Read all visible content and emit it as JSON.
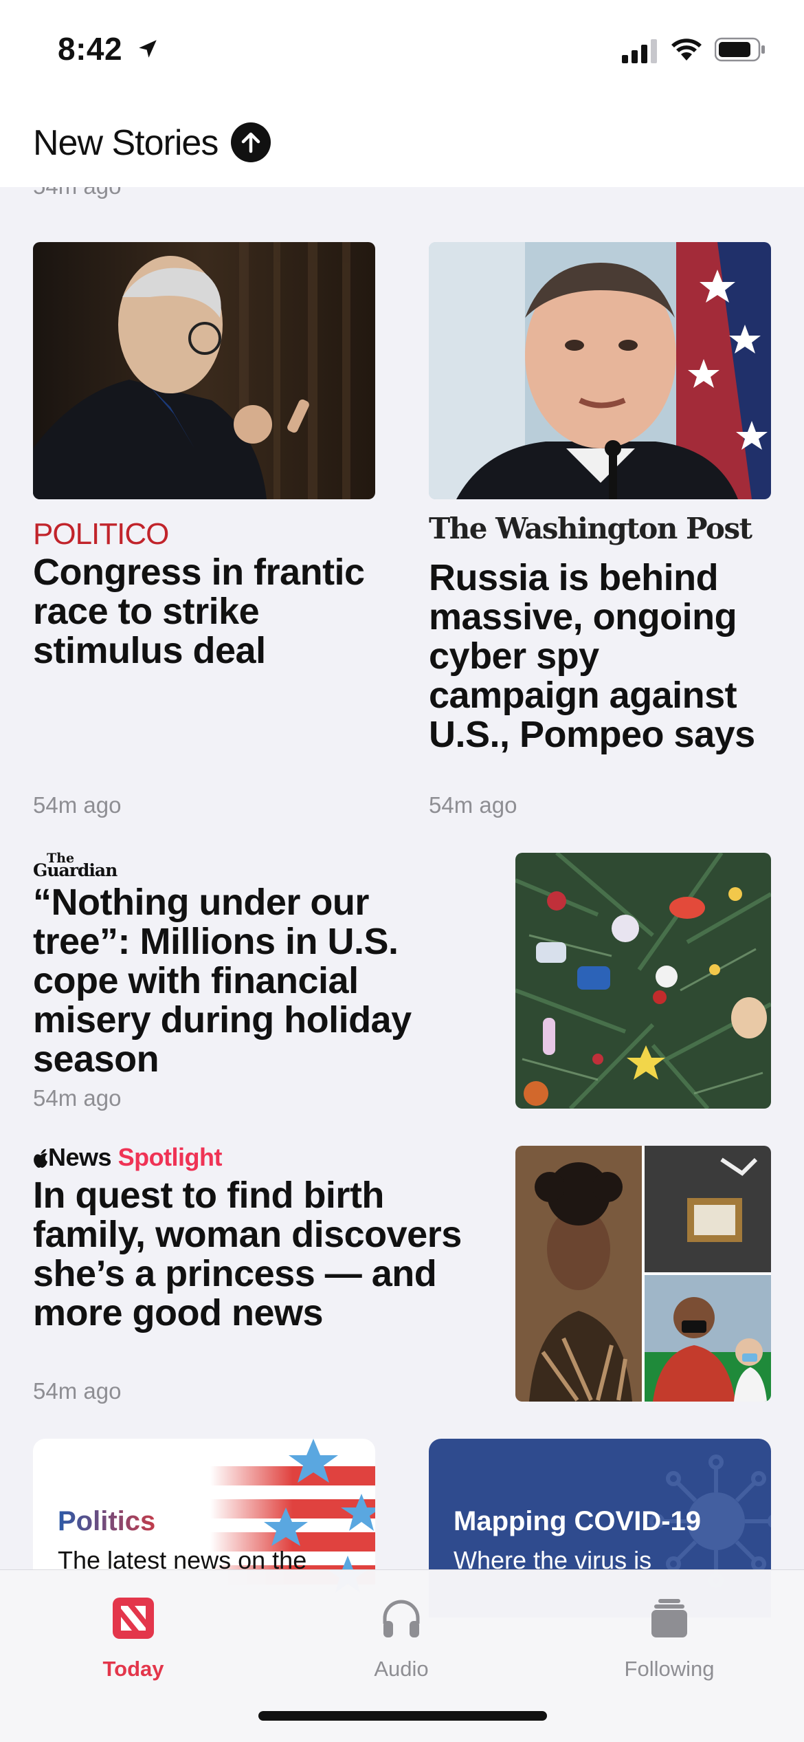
{
  "status_bar": {
    "time": "8:42"
  },
  "header": {
    "title": "New Stories"
  },
  "clipped_time": "54m ago",
  "stories": [
    {
      "publisher": "POLITICO",
      "headline": "Congress in frantic race to strike stimulus deal",
      "time": "54m ago",
      "image": "mitch-mcconnell-photo"
    },
    {
      "publisher": "The Washington Post",
      "headline": "Russia is behind massive, ongoing cyber spy campaign against U.S., Pompeo says",
      "time": "54m ago",
      "image": "mike-pompeo-photo"
    },
    {
      "publisher_top": "The",
      "publisher_bottom": "Guardian",
      "headline": "“Nothing under our tree”: Millions in U.S. cope with financial misery during holiday season",
      "time": "54m ago",
      "image": "christmas-tree-photo"
    },
    {
      "publisher_news": "News",
      "publisher_spotlight": "Spotlight",
      "headline": "In quest to find birth family, woman discovers she’s a princess — and more good news",
      "time": "54m ago",
      "image": "good-news-collage"
    }
  ],
  "topics": [
    {
      "title": "Politics",
      "subtitle": "The latest news on the"
    },
    {
      "title": "Mapping COVID-19",
      "subtitle": "Where the virus is"
    }
  ],
  "tabs": [
    {
      "label": "Today",
      "icon": "news-icon",
      "active": true
    },
    {
      "label": "Audio",
      "icon": "headphones-icon",
      "active": false
    },
    {
      "label": "Following",
      "icon": "following-stack-icon",
      "active": false
    }
  ],
  "colors": {
    "accent": "#e3364b",
    "politico": "#c1242b",
    "spotlight": "#ef3355",
    "covid_card": "#2f4b8e"
  }
}
